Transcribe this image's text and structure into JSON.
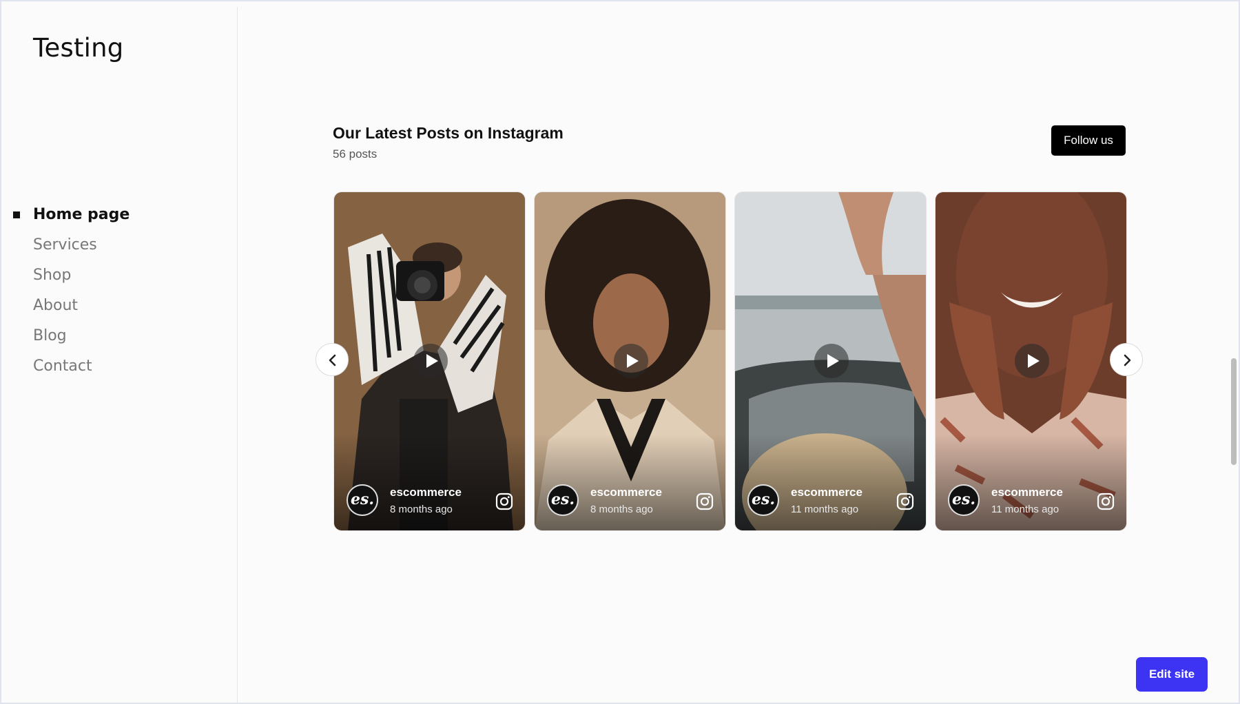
{
  "site": {
    "title": "Testing"
  },
  "nav": {
    "items": [
      {
        "label": "Home page",
        "active": true
      },
      {
        "label": "Services",
        "active": false
      },
      {
        "label": "Shop",
        "active": false
      },
      {
        "label": "About",
        "active": false
      },
      {
        "label": "Blog",
        "active": false
      },
      {
        "label": "Contact",
        "active": false
      }
    ]
  },
  "feed": {
    "title": "Our Latest Posts on Instagram",
    "count": "56 posts",
    "follow_label": "Follow us",
    "posts": [
      {
        "author": "escommerce",
        "avatar_text": "es.",
        "time": "8 months ago",
        "icon": "instagram-icon"
      },
      {
        "author": "escommerce",
        "avatar_text": "es.",
        "time": "8 months ago",
        "icon": "instagram-icon"
      },
      {
        "author": "escommerce",
        "avatar_text": "es.",
        "time": "11 months ago",
        "icon": "instagram-icon"
      },
      {
        "author": "escommerce",
        "avatar_text": "es.",
        "time": "11 months ago",
        "icon": "instagram-icon"
      }
    ]
  },
  "edit_button": {
    "label": "Edit site"
  },
  "colors": {
    "accent": "#3d34f3",
    "follow_bg": "#000000"
  }
}
